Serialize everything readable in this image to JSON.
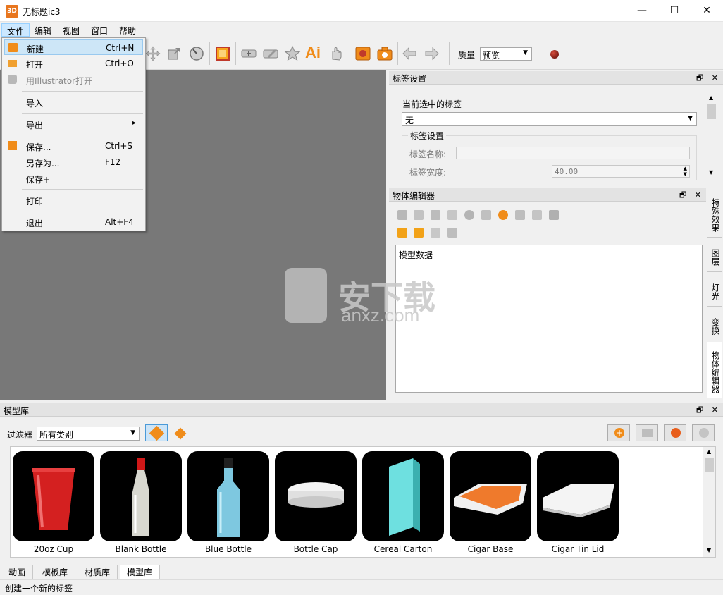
{
  "window": {
    "title": "无标题ic3",
    "app_icon_text": "3D",
    "minimize": "—",
    "maximize": "☐",
    "close": "✕"
  },
  "menubar": [
    "文件",
    "编辑",
    "视图",
    "窗口",
    "帮助"
  ],
  "file_menu": {
    "items": [
      {
        "label": "新建",
        "shortcut": "Ctrl+N"
      },
      {
        "label": "打开",
        "shortcut": "Ctrl+O"
      },
      {
        "label": "用Illustrator打开",
        "shortcut": ""
      },
      {
        "label": "导入",
        "shortcut": ""
      },
      {
        "label": "导出",
        "shortcut": "▸"
      },
      {
        "label": "保存...",
        "shortcut": "Ctrl+S"
      },
      {
        "label": "另存为...",
        "shortcut": "F12"
      },
      {
        "label": "保存+",
        "shortcut": ""
      },
      {
        "label": "打印",
        "shortcut": ""
      },
      {
        "label": "退出",
        "shortcut": "Alt+F4"
      }
    ]
  },
  "toolbar": {
    "quality_label": "质量",
    "quality_value": "预览",
    "ai_text": "Ai"
  },
  "label_panel": {
    "title": "标签设置",
    "current_label_caption": "当前选中的标签",
    "current_label_value": "无",
    "group_title": "标签设置",
    "name_label": "标签名称:",
    "name_value": "",
    "width_label": "标签宽度:",
    "width_value": "40.00"
  },
  "object_editor": {
    "title": "物体编辑器",
    "tree_root": "模型数据"
  },
  "side_tabs": [
    "特殊效果",
    "图层",
    "灯光",
    "变换",
    "物体编辑器"
  ],
  "model_library": {
    "title": "模型库",
    "filter_label": "过滤器",
    "filter_value": "所有类别",
    "items": [
      "20oz Cup",
      "Blank Bottle",
      "Blue Bottle",
      "Bottle Cap",
      "Cereal Carton",
      "Cigar Base",
      "Cigar Tin Lid"
    ]
  },
  "bottom_tabs": [
    "动画",
    "模板库",
    "材质库",
    "模型库"
  ],
  "status_text": "创建一个新的标签",
  "watermark": {
    "cn": "安下载",
    "en": "anxz.com"
  },
  "panel_buttons": "🗗 ✕"
}
